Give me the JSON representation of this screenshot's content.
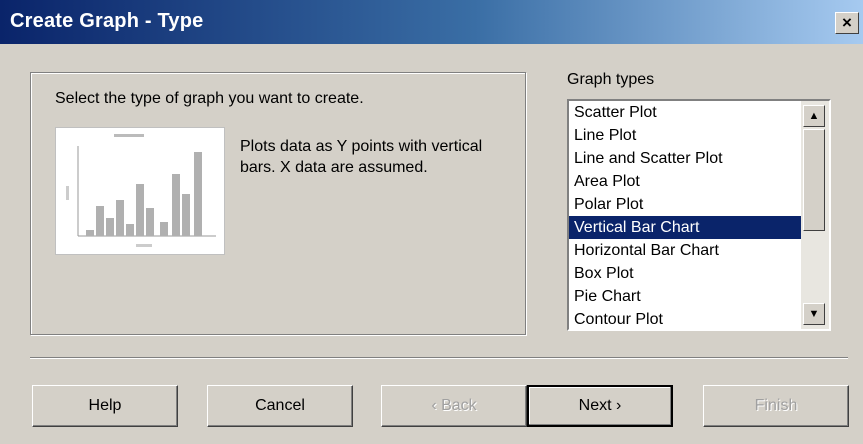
{
  "window": {
    "title": "Create Graph - Type",
    "close_label": "×"
  },
  "main": {
    "instruction": "Select the type of graph you want to create.",
    "description": "Plots data as Y points with vertical bars. X data are assumed."
  },
  "graph_types": {
    "label": "Graph types",
    "items": [
      "Scatter Plot",
      "Line Plot",
      "Line and Scatter Plot",
      "Area Plot",
      "Polar Plot",
      "Vertical Bar Chart",
      "Horizontal Bar Chart",
      "Box Plot",
      "Pie Chart",
      "Contour Plot"
    ],
    "selected": "Vertical Bar Chart"
  },
  "scrollbar": {
    "up_icon": "▲",
    "down_icon": "▼"
  },
  "buttons": {
    "help": "Help",
    "cancel": "Cancel",
    "back": "‹ Back",
    "next": "Next ›",
    "finish": "Finish"
  },
  "colors": {
    "selection": "#0a246a",
    "title_start": "#0a246a",
    "title_end": "#a6caf0",
    "face": "#d4d0c8"
  }
}
